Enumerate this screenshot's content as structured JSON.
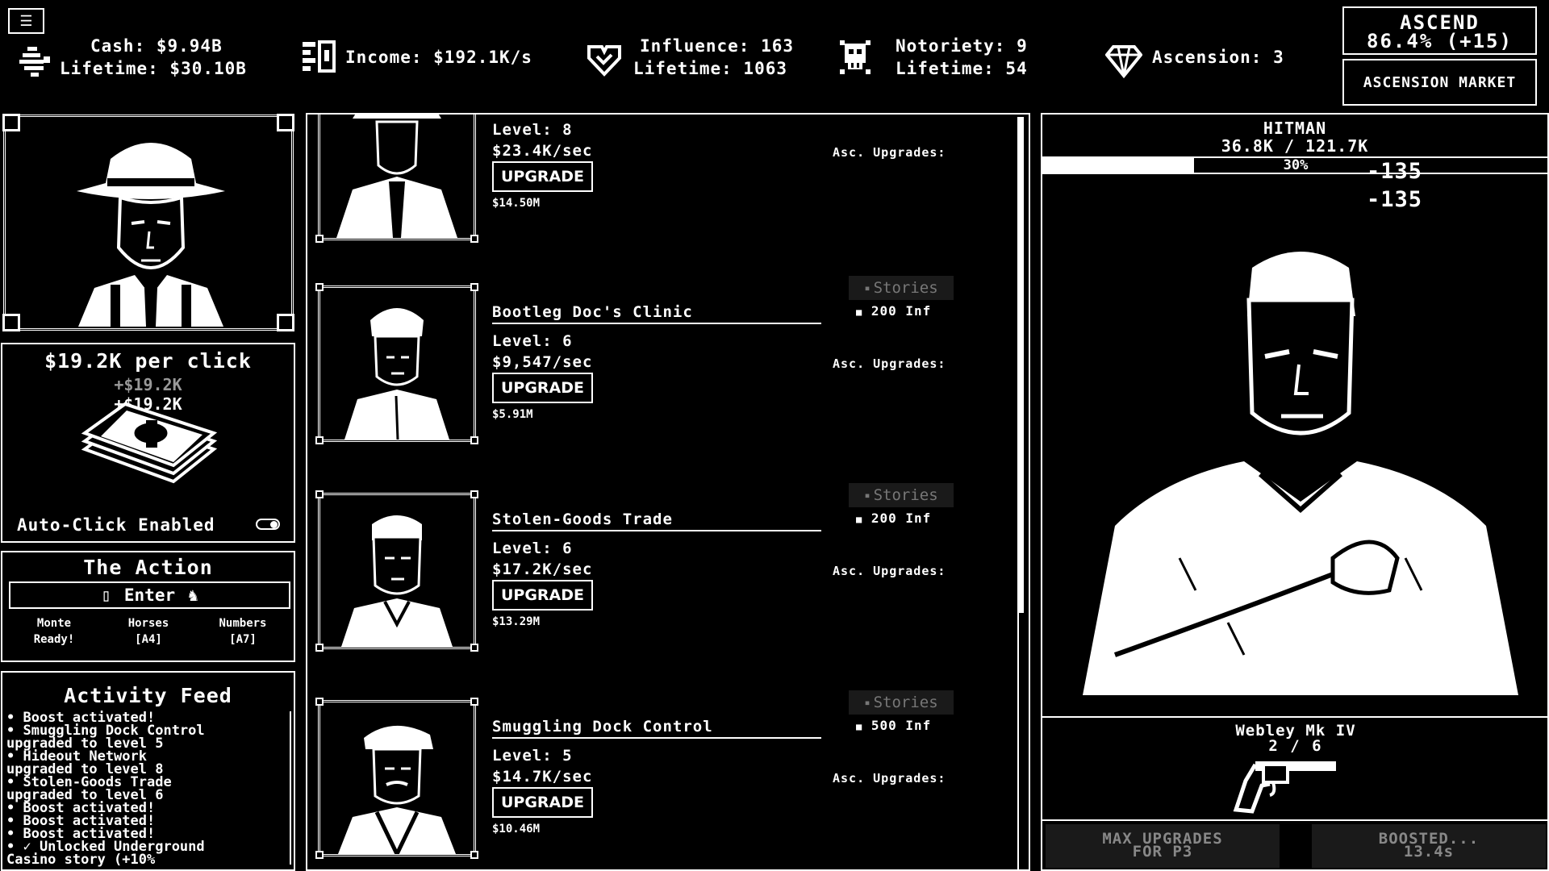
{
  "top": {
    "menu_glyph": "☰",
    "cash": "Cash: $9.94B",
    "cash_lifetime": "Lifetime: $30.10B",
    "income": "Income: $192.1K/s",
    "influence": "Influence: 163",
    "influence_lifetime": "Lifetime: 1063",
    "notoriety": "Notoriety: 9",
    "notoriety_lifetime": "Lifetime: 54",
    "ascension": "Ascension: 3",
    "ascend_label": "ASCEND",
    "ascend_value": "86.4% (+15)",
    "market_label": "ASCENSION MARKET"
  },
  "click": {
    "per_click": "$19.2K per click",
    "gain_1": "+$19.2K",
    "gain_2": "+$19.2K",
    "autoclick_label": "Auto-Click Enabled",
    "autoclick_on": true
  },
  "action": {
    "title": "The Action",
    "enter_label": "Enter",
    "games": [
      {
        "name": "Monte",
        "status": "Ready!"
      },
      {
        "name": "Horses",
        "status": "[A4]"
      },
      {
        "name": "Numbers",
        "status": "[A7]"
      }
    ]
  },
  "feed": {
    "title": "Activity Feed",
    "items": [
      "• Boost activated!",
      "• Smuggling Dock Control",
      "upgraded to level 5",
      "• Hideout Network",
      "upgraded to level 8",
      "• Stolen-Goods Trade",
      "upgraded to level 6",
      "• Boost activated!",
      "• Boost activated!",
      "• Boost activated!",
      "• ✓ Unlocked Underground",
      "Casino story (+10%"
    ]
  },
  "businesses": [
    {
      "name": "",
      "level": "Level: 8",
      "rate": "$23.4K/sec",
      "upgrade": "UPGRADE",
      "cost": "$14.50M",
      "stories": "",
      "lock": "",
      "asc": "Asc. Upgrades:"
    },
    {
      "name": "Bootleg Doc's Clinic",
      "level": "Level: 6",
      "rate": "$9,547/sec",
      "upgrade": "UPGRADE",
      "cost": "$5.91M",
      "stories": "Stories",
      "lock": "200 Inf",
      "asc": "Asc. Upgrades:"
    },
    {
      "name": "Stolen-Goods Trade",
      "level": "Level: 6",
      "rate": "$17.2K/sec",
      "upgrade": "UPGRADE",
      "cost": "$13.29M",
      "stories": "Stories",
      "lock": "200 Inf",
      "asc": "Asc. Upgrades:"
    },
    {
      "name": "Smuggling Dock Control",
      "level": "Level: 5",
      "rate": "$14.7K/sec",
      "upgrade": "UPGRADE",
      "cost": "$10.46M",
      "stories": "Stories",
      "lock": "500 Inf",
      "asc": "Asc. Upgrades:"
    }
  ],
  "boss": {
    "name": "HITMAN",
    "hp_text": "36.8K / 121.7K",
    "hp_fraction": 0.3,
    "hp_pct": "30%",
    "damage_1": "-135",
    "damage_2": "-135",
    "weapon_name": "Webley Mk IV",
    "weapon_count": "2 / 6",
    "btn_left_1": "MAX UPGRADES",
    "btn_left_2": "FOR P3",
    "btn_right_1": "BOOSTED...",
    "btn_right_2": "13.4s"
  },
  "colors": {
    "bg": "#000000",
    "fg": "#ffffff",
    "disabled": "#888888"
  }
}
